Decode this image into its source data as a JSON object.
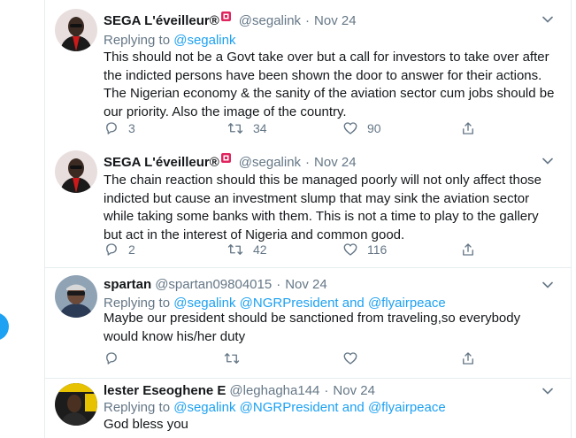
{
  "tweets": [
    {
      "name": "SEGA L'éveilleur®",
      "handle": "@segalink",
      "date": "Nov 24",
      "replying_label": "Replying to",
      "mentions": "@segalink",
      "text": "This should not be a Govt take over but a call for investors to take over after the indicted persons have been shown the door to answer for their actions. The Nigerian economy & the sanity of the aviation sector cum jobs should be our priority. Also the image of the country.",
      "replies": "3",
      "retweets": "34",
      "likes": "90",
      "avatar_colors": {
        "bg": "#f0e6e6",
        "face": "#3b2a22",
        "suit": "#1a1a1a",
        "scarf": "#cc1a1a"
      }
    },
    {
      "name": "SEGA L'éveilleur®",
      "handle": "@segalink",
      "date": "Nov 24",
      "replying_label": "",
      "mentions": "",
      "text": "The chain reaction should this be managed poorly will not only affect those indicted but cause an investment slump that may sink the aviation sector while taking some banks with them. This is not a time to play to the gallery but act in the interest of Nigeria and common good.",
      "replies": "2",
      "retweets": "42",
      "likes": "116",
      "avatar_colors": {
        "bg": "#f0e6e6",
        "face": "#3b2a22",
        "suit": "#1a1a1a",
        "scarf": "#cc1a1a"
      }
    },
    {
      "name": "spartan",
      "handle": "@spartan09804015",
      "date": "Nov 24",
      "replying_label": "Replying to",
      "mentions": "@segalink @NGRPresident and @flyairpeace",
      "text": "Maybe our president should be sanctioned from traveling,so everybody would know his/her duty",
      "replies": "",
      "retweets": "",
      "likes": "",
      "avatar_colors": {
        "bg": "#8fa3b5",
        "face": "#6b4a3a",
        "suit": "#2b3a55",
        "scarf": "#d8d8d8"
      }
    },
    {
      "name": "lester Eseoghene E",
      "handle": "@leghagha144",
      "date": "Nov 24",
      "replying_label": "Replying to",
      "mentions": "@segalink @NGRPresident and @flyairpeace",
      "text": "God bless you",
      "replies": "",
      "retweets": "",
      "likes": "",
      "avatar_colors": {
        "bg": "#1c1c1c",
        "face": "#4a3020",
        "suit": "#e6c200",
        "scarf": "#2a2a2a"
      }
    }
  ],
  "icons": {
    "reply": "reply-icon",
    "retweet": "retweet-icon",
    "like": "heart-icon",
    "share": "share-icon",
    "more": "chevron-down-icon",
    "badge": "red-badge-icon"
  },
  "colors": {
    "link": "#1da1f2",
    "muted": "#657786",
    "text": "#14171a",
    "border": "#e6ecf0",
    "badge": "#e0245e"
  }
}
